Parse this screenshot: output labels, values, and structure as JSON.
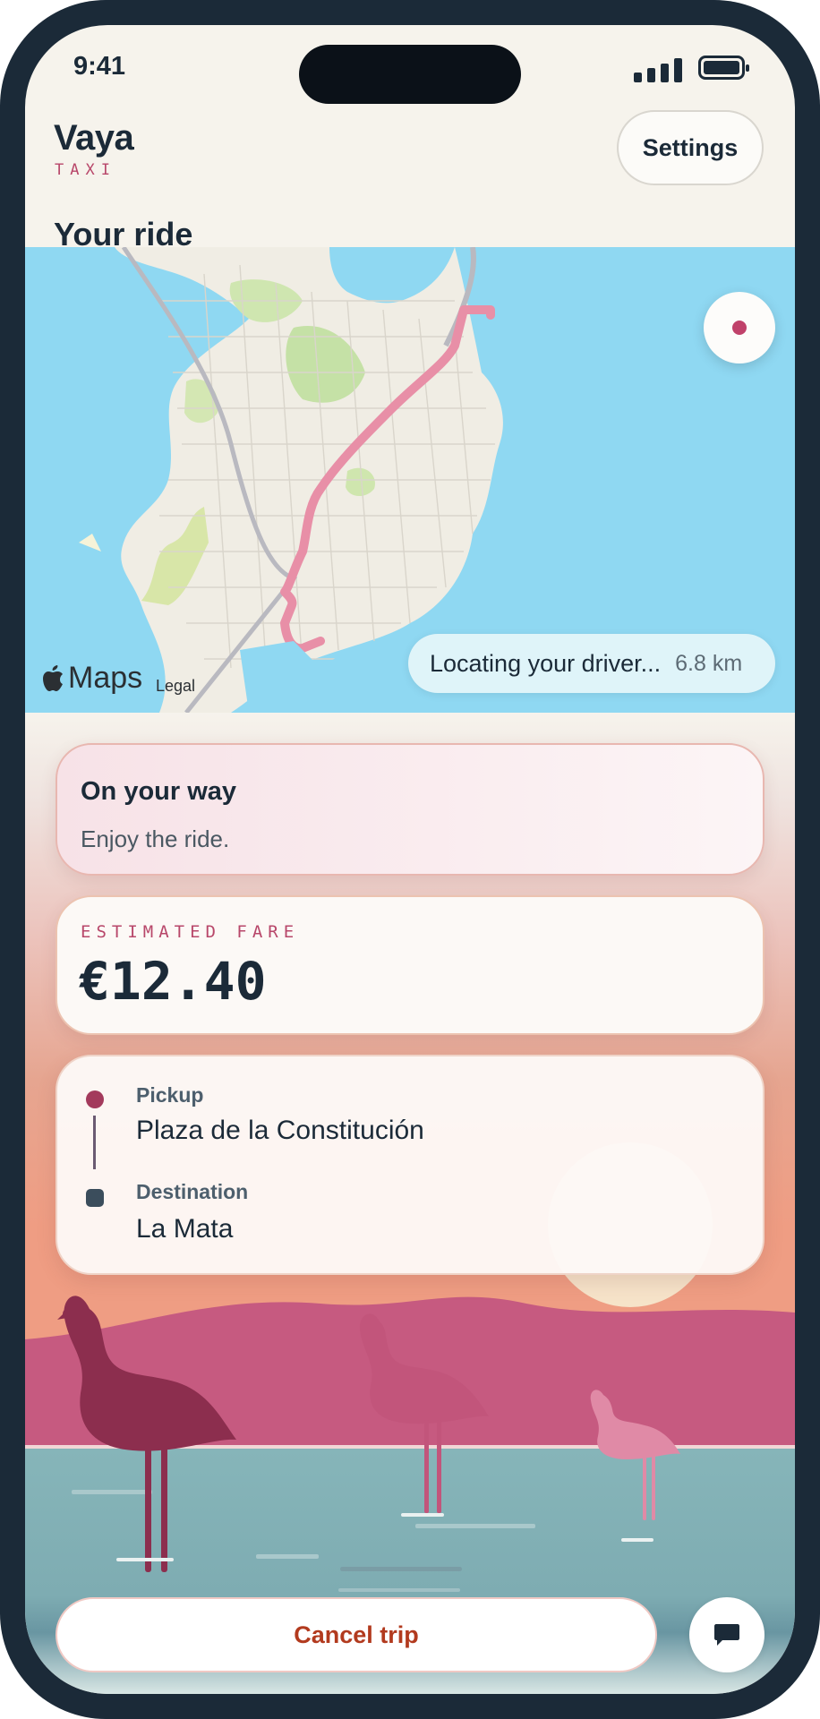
{
  "status_bar": {
    "time": "9:41"
  },
  "header": {
    "brand": "Vaya",
    "brand_sub": "TAXI",
    "settings_label": "Settings"
  },
  "page_title": "Your ride",
  "map": {
    "attribution_logo": "Maps",
    "attribution_legal": "Legal",
    "locating_text": "Locating your driver...",
    "distance": "6.8 km"
  },
  "status_card": {
    "heading": "On your way",
    "subtext": "Enjoy the ride."
  },
  "fare_card": {
    "label": "ESTIMATED FARE",
    "value": "€12.40"
  },
  "route": {
    "pickup_label": "Pickup",
    "pickup_value": "Plaza de la Constitución",
    "destination_label": "Destination",
    "destination_value": "La Mata"
  },
  "actions": {
    "cancel_label": "Cancel trip",
    "chat_icon": "chat-icon"
  },
  "colors": {
    "accent": "#b8476a",
    "ink": "#1b2a38",
    "route": "#e88fa7",
    "water": "#8fd8f2",
    "cancel_text": "#b23a1e"
  }
}
